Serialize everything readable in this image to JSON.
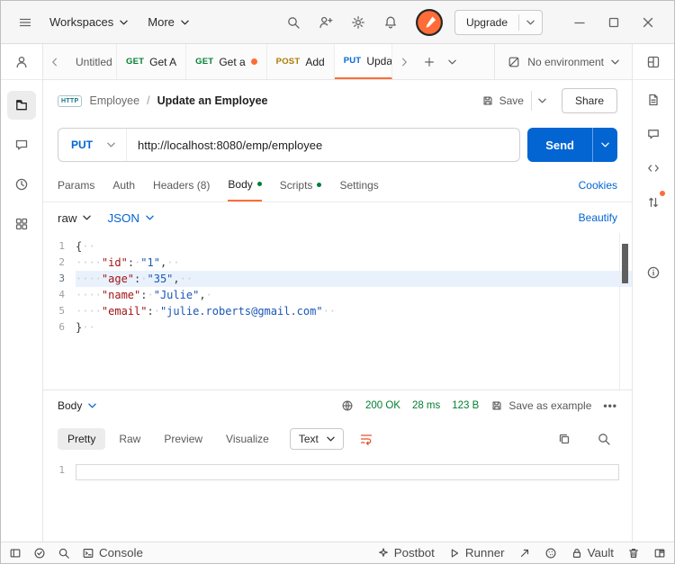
{
  "topbar": {
    "workspaces": "Workspaces",
    "more": "More",
    "upgrade": "Upgrade"
  },
  "tabbar": {
    "tabs": [
      {
        "method": "",
        "label": "Untitled"
      },
      {
        "method": "GET",
        "label": "Get A"
      },
      {
        "method": "GET",
        "label": "Get a"
      },
      {
        "method": "POST",
        "label": "Add"
      },
      {
        "method": "PUT",
        "label": "Updat"
      }
    ],
    "environment": "No environment"
  },
  "request": {
    "breadcrumb": {
      "chip": "HTTP",
      "collection": "Employee",
      "sep": "/",
      "name": "Update an Employee"
    },
    "save": "Save",
    "share": "Share",
    "method": "PUT",
    "url": "http://localhost:8080/emp/employee",
    "send": "Send",
    "tabs": [
      {
        "label": "Params"
      },
      {
        "label": "Auth"
      },
      {
        "label": "Headers (8)"
      },
      {
        "label": "Body"
      },
      {
        "label": "Scripts"
      },
      {
        "label": "Settings"
      }
    ],
    "cookies": "Cookies",
    "body_type": "raw",
    "language": "JSON",
    "beautify": "Beautify",
    "editor": {
      "lines": [
        {
          "n": "1",
          "ws1": "",
          "k": "",
          "c": "",
          "ws2": "",
          "v": "",
          "p": "{",
          "ws3": "··"
        },
        {
          "n": "2",
          "ws1": "····",
          "k": "\"id\"",
          "c": ":",
          "ws2": "·",
          "v": "\"1\"",
          "p": ",",
          "ws3": "··"
        },
        {
          "n": "3",
          "ws1": "····",
          "k": "\"age\"",
          "c": ":",
          "ws2": "·",
          "v": "\"35\"",
          "p": ",",
          "ws3": "··"
        },
        {
          "n": "4",
          "ws1": "····",
          "k": "\"name\"",
          "c": ":",
          "ws2": "·",
          "v": "\"Julie\"",
          "p": ",",
          "ws3": "·"
        },
        {
          "n": "5",
          "ws1": "····",
          "k": "\"email\"",
          "c": ":",
          "ws2": "·",
          "v": "\"julie.roberts@gmail.com\"",
          "p": "",
          "ws3": "··"
        },
        {
          "n": "6",
          "ws1": "",
          "k": "",
          "c": "",
          "ws2": "",
          "v": "",
          "p": "}",
          "ws3": "··"
        }
      ]
    }
  },
  "response": {
    "body": "Body",
    "status": "200 OK",
    "time": "28 ms",
    "size": "123 B",
    "save_example": "Save as example",
    "tabs": [
      "Pretty",
      "Raw",
      "Preview",
      "Visualize"
    ],
    "format": "Text",
    "line": "1"
  },
  "statusbar": {
    "console": "Console",
    "postbot": "Postbot",
    "runner": "Runner",
    "vault": "Vault"
  },
  "colors": {
    "accent_orange": "#ff6c37",
    "send_blue": "#0265d2",
    "get_green": "#007f31",
    "post_yellow": "#ad7a03",
    "put_blue": "#0265d2",
    "status_green": "#007f31"
  }
}
